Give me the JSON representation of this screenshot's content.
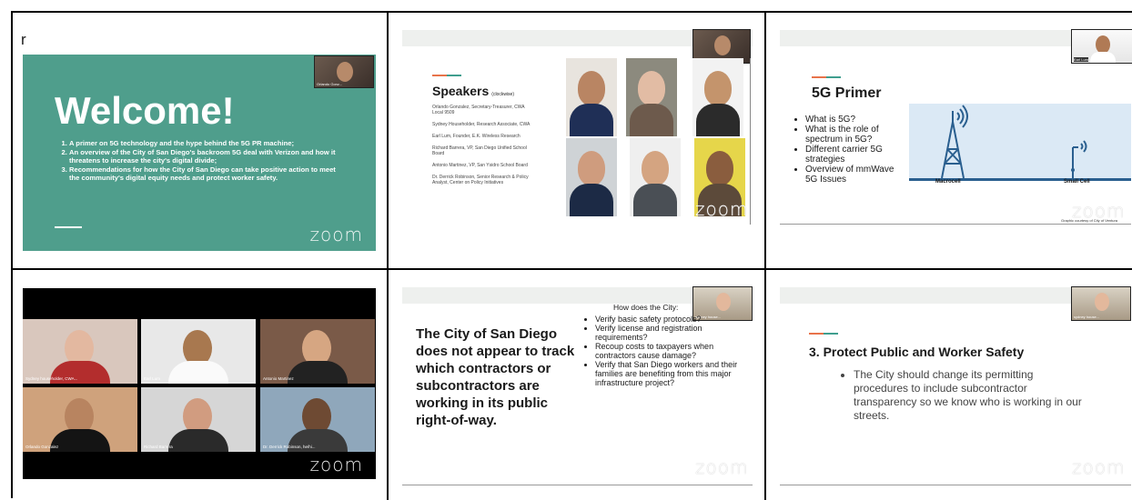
{
  "cell1": {
    "stray_char": "r",
    "thumb_name": "Orlando Gonz...",
    "title": "Welcome!",
    "items": [
      "A primer on 5G technology and the hype behind the 5G PR machine;",
      "An overview of the City of San Diego's backroom 5G deal with Verizon and how it threatens to increase the city's digital divide;",
      "Recommendations for how the City of San Diego can take positive action to meet the community's digital equity needs and protect worker safety."
    ],
    "watermark": "zoom"
  },
  "cell2": {
    "thumb_name": "Orlando Gonz...",
    "title": "Speakers",
    "subtitle": "(clockwise)",
    "speakers": [
      "Orlando Gonzalez, Secretary-Treasurer, CWA Local 9509",
      "Sydney Householder, Research Associate, CWA",
      "Earl Lum, Founder, E.K. Wireless Research",
      "Richard Barrera, VP, San Diego Unified School Board",
      "Antonio Martinez, VP, San Ysidro School Board",
      "Dr. Derrick Robinson, Senior Research & Policy Analyst, Center on Policy Initiatives"
    ],
    "watermark": "zoom"
  },
  "cell3": {
    "thumb_name": "Earl Lum",
    "title": "5G Primer",
    "items": [
      "What is 5G?",
      "What is the role of spectrum in 5G?",
      "Different carrier 5G strategies",
      "Overview of mmWave 5G Issues"
    ],
    "macro_label": "Macrocell",
    "small_label": "Small Cell",
    "credit": "Graphic courtesy of City of Ventura",
    "watermark": "zoom"
  },
  "cell4": {
    "participants": [
      "Sydney householder, CWA...",
      "Earl Lum",
      "Antonio Martinez",
      "Orlando Gonzalez",
      "Richard Barrera",
      "Dr. Derrick Robinson, he/hi..."
    ],
    "watermark": "zoom"
  },
  "cell5": {
    "thumb_name": "sydney house...",
    "statement": "The City of San Diego does not appear to track which contractors or subcontractors are working in its public right-of-way.",
    "how_title": "How does the City:",
    "items": [
      "Verify basic safety protocols?",
      "Verify license and registration requirements?",
      "Recoup costs to taxpayers when contractors cause damage?",
      "Verify that San Diego workers and their families are benefiting from this major infrastructure project?"
    ],
    "watermark": "zoom"
  },
  "cell6": {
    "thumb_name": "sydney house...",
    "title": "3. Protect Public and Worker Safety",
    "items": [
      "The City should change its permitting procedures to include subcontractor transparency so we know who is working in our streets."
    ],
    "watermark": "zoom"
  },
  "colors": {
    "teal": "#4f9e8c",
    "sky": "#dbe9f5",
    "tower": "#2a5f8f"
  }
}
